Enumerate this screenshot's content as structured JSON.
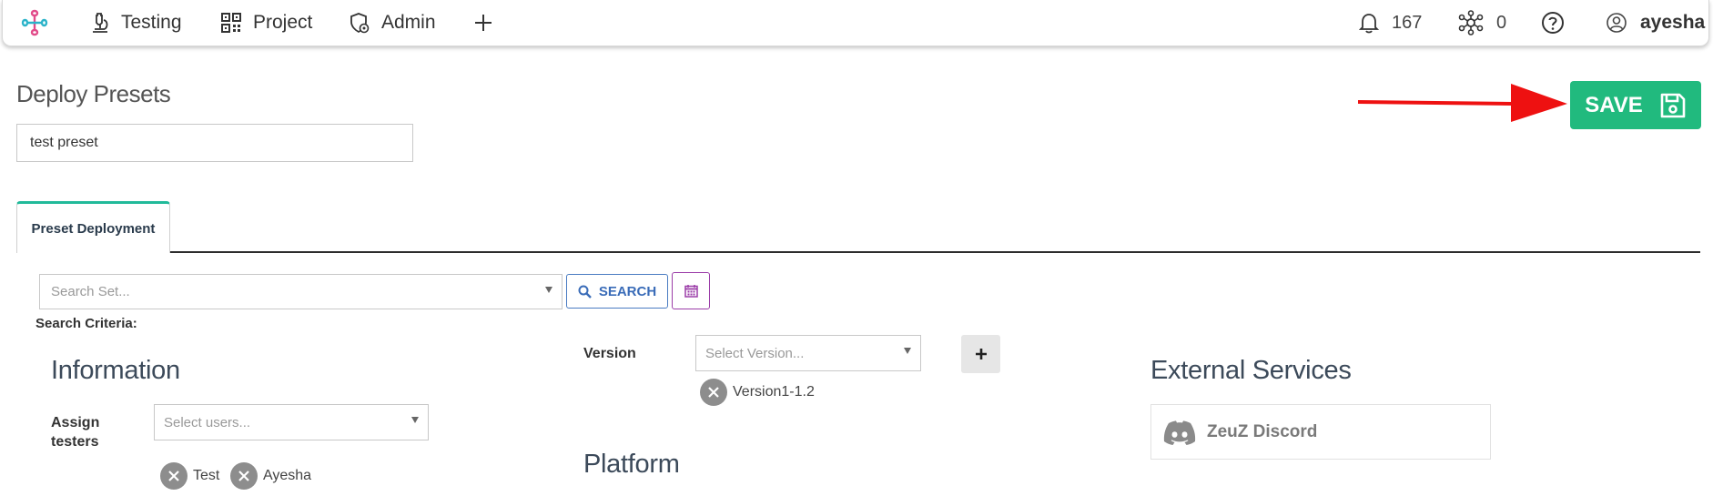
{
  "nav": {
    "items": [
      {
        "label": "Testing",
        "icon": "microscope-icon"
      },
      {
        "label": "Project",
        "icon": "qr-grid-icon"
      },
      {
        "label": "Admin",
        "icon": "shield-gear-icon"
      }
    ],
    "add_icon": "plus-icon",
    "notifications_count": "167",
    "nodes_count": "0",
    "help_icon": "question-circle-icon",
    "username": "ayesha"
  },
  "page": {
    "title": "Deploy Presets",
    "preset_name_value": "test preset",
    "save_label": "SAVE"
  },
  "tabs": [
    {
      "label": "Preset Deployment",
      "active": true
    }
  ],
  "search": {
    "placeholder": "Search Set...",
    "button_label": "SEARCH",
    "criteria_label": "Search Criteria:"
  },
  "information": {
    "title": "Information",
    "assign_label_line1": "Assign",
    "assign_label_line2": "testers",
    "users_placeholder": "Select users...",
    "selected_users": [
      "Test",
      "Ayesha"
    ]
  },
  "version": {
    "label": "Version",
    "placeholder": "Select Version...",
    "selected": [
      "Version1-1.2"
    ]
  },
  "platform": {
    "title": "Platform"
  },
  "external_services": {
    "title": "External Services",
    "services": [
      {
        "name": "ZeuZ Discord",
        "icon": "discord-icon"
      }
    ]
  },
  "colors": {
    "accent_green": "#21ba7e",
    "arrow_red": "#ee1111",
    "tab_accent": "#21ba9a",
    "search_blue": "#3a6cb8",
    "calendar_purple": "#9b3da8"
  }
}
